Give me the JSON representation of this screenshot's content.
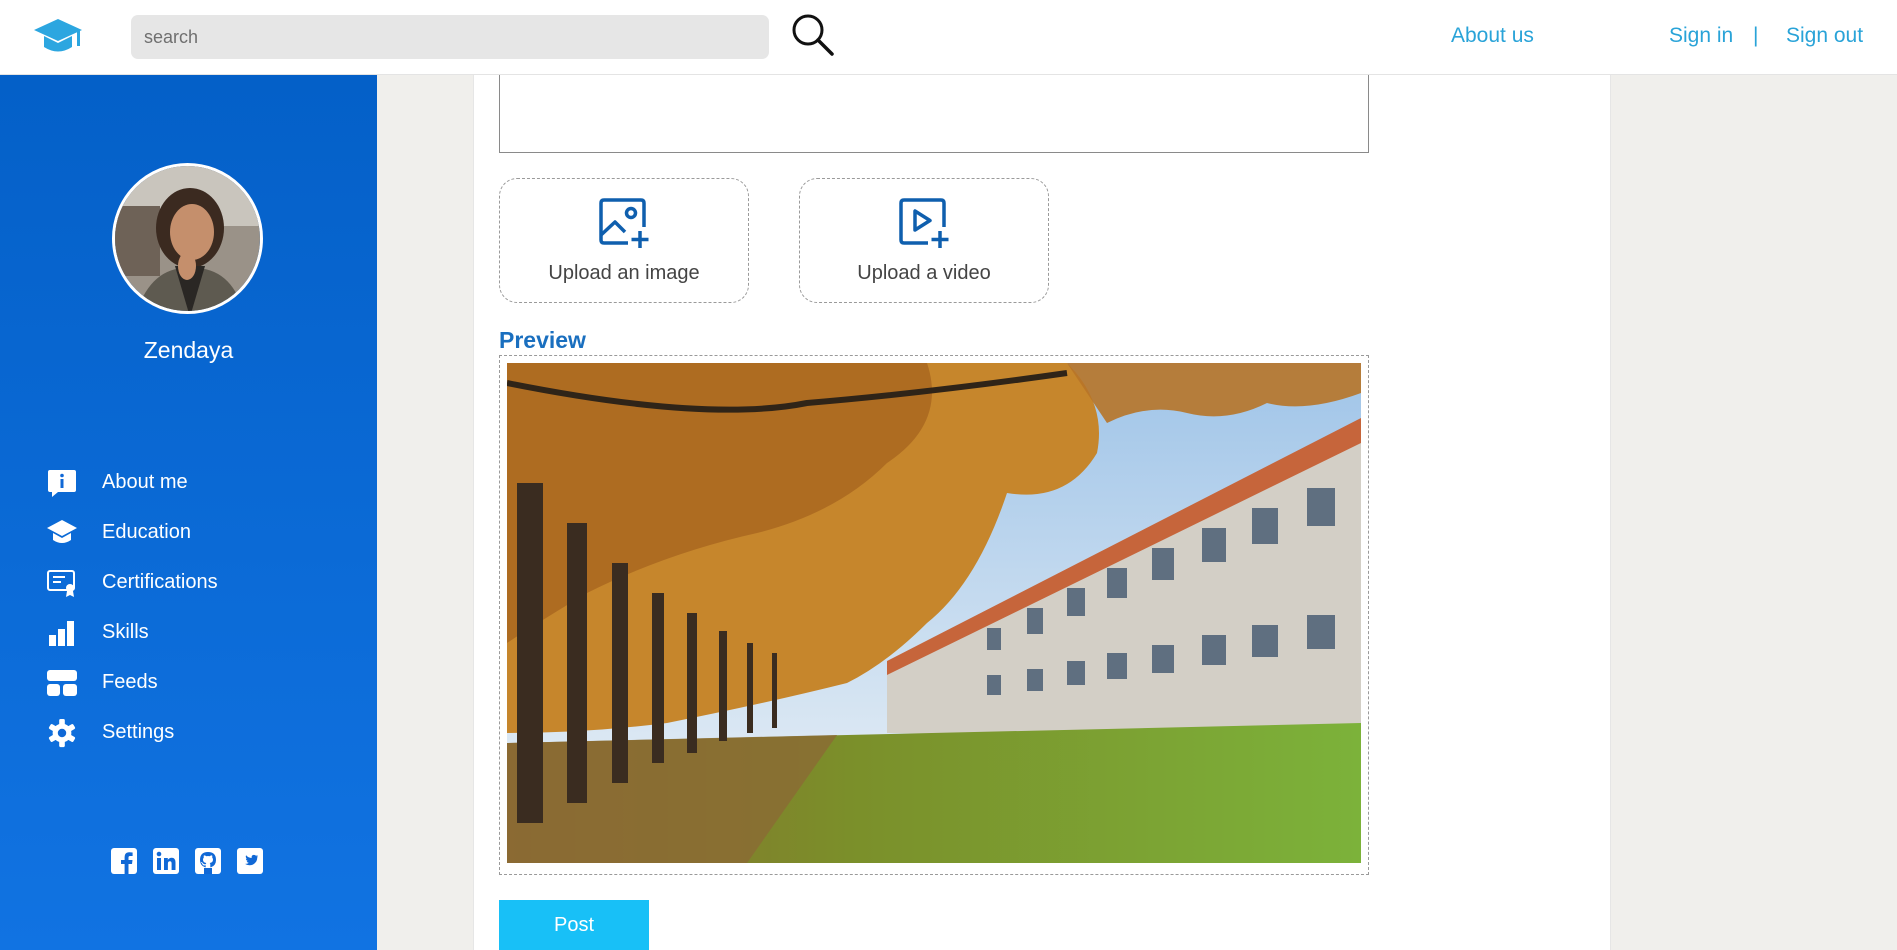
{
  "header": {
    "search_placeholder": "search",
    "links": {
      "about_us": "About us",
      "sign_in": "Sign in",
      "separator": "|",
      "sign_out": "Sign out"
    }
  },
  "sidebar": {
    "profile_name": "Zendaya",
    "items": [
      {
        "label": "About me",
        "icon": "info-icon"
      },
      {
        "label": "Education",
        "icon": "graduation-cap-icon"
      },
      {
        "label": "Certifications",
        "icon": "certificate-icon"
      },
      {
        "label": "Skills",
        "icon": "bar-chart-icon"
      },
      {
        "label": "Feeds",
        "icon": "feeds-icon"
      },
      {
        "label": "Settings",
        "icon": "gear-icon"
      }
    ],
    "socials": [
      "facebook-icon",
      "linkedin-icon",
      "github-icon",
      "twitter-icon"
    ]
  },
  "main": {
    "upload_image_label": "Upload an image",
    "upload_video_label": "Upload a video",
    "preview_title": "Preview",
    "post_label": "Post"
  },
  "colors": {
    "sidebar": "#0460c8",
    "link": "#29a3d8",
    "preview_title": "#1a6fbf",
    "post_button": "#18c0f7"
  }
}
